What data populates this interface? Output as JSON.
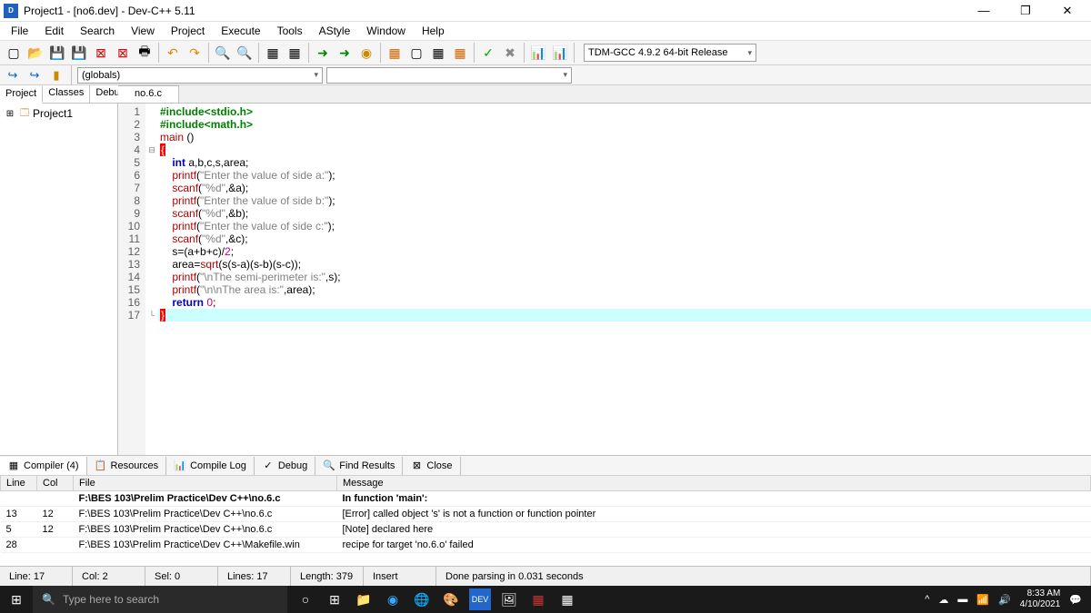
{
  "titlebar": {
    "title": "Project1 - [no6.dev] - Dev-C++ 5.11"
  },
  "menu": [
    "File",
    "Edit",
    "Search",
    "View",
    "Project",
    "Execute",
    "Tools",
    "AStyle",
    "Window",
    "Help"
  ],
  "compiler_select": "TDM-GCC 4.9.2 64-bit Release",
  "scope_select": "(globals)",
  "left_tabs": [
    "Project",
    "Classes",
    "Debug"
  ],
  "left_tab_active": 0,
  "project_name": "Project1",
  "file_tabs": [
    "no.6.c"
  ],
  "code_lines": [
    {
      "n": 1,
      "html": "<span class='kw-green'>#include&lt;stdio.h&gt;</span>"
    },
    {
      "n": 2,
      "html": "<span class='kw-green'>#include&lt;math.h&gt;</span>"
    },
    {
      "n": 3,
      "html": "<span class='kw-red'>main</span> ()\n"
    },
    {
      "n": 4,
      "html": "<span class='brace'>{</span>"
    },
    {
      "n": 5,
      "html": "    <span class='kw-blue'>int</span> a,b,c,s,area;"
    },
    {
      "n": 6,
      "html": "    <span class='kw-red'>printf</span>(<span class='kw-str'>\"Enter the value of side a:\"</span>);"
    },
    {
      "n": 7,
      "html": "    <span class='kw-red'>scanf</span>(<span class='kw-str'>\"%d\"</span>,&amp;a);"
    },
    {
      "n": 8,
      "html": "    <span class='kw-red'>printf</span>(<span class='kw-str'>\"Enter the value of side b:\"</span>);"
    },
    {
      "n": 9,
      "html": "    <span class='kw-red'>scanf</span>(<span class='kw-str'>\"%d\"</span>,&amp;b);"
    },
    {
      "n": 10,
      "html": "    <span class='kw-red'>printf</span>(<span class='kw-str'>\"Enter the value of side c:\"</span>);"
    },
    {
      "n": 11,
      "html": "    <span class='kw-red'>scanf</span>(<span class='kw-str'>\"%d\"</span>,&amp;c);"
    },
    {
      "n": 12,
      "html": "    s=(a+b+c)/<span class='kw-num'>2</span>;"
    },
    {
      "n": 13,
      "html": "    area=<span class='kw-red'>sqrt</span>(s(s-a)(s-b)(s-c));"
    },
    {
      "n": 14,
      "html": "    <span class='kw-red'>printf</span>(<span class='kw-str'>\"\\nThe semi-perimeter is:\"</span>,s);"
    },
    {
      "n": 15,
      "html": "    <span class='kw-red'>printf</span>(<span class='kw-str'>\"\\n\\nThe area is:\"</span>,area);"
    },
    {
      "n": 16,
      "html": "    <span class='kw-blue'>return</span> <span class='kw-num'>0</span>;"
    },
    {
      "n": 17,
      "html": "<span class='brace'>}</span>"
    }
  ],
  "bottom_tabs": [
    {
      "icon": "▦",
      "label": "Compiler (4)"
    },
    {
      "icon": "📋",
      "label": "Resources"
    },
    {
      "icon": "📊",
      "label": "Compile Log"
    },
    {
      "icon": "✓",
      "label": "Debug"
    },
    {
      "icon": "🔍",
      "label": "Find Results"
    },
    {
      "icon": "⊠",
      "label": "Close"
    }
  ],
  "compiler_headers": [
    "Line",
    "Col",
    "File",
    "Message"
  ],
  "compiler_rows": [
    {
      "line": "",
      "col": "",
      "file": "F:\\BES 103\\Prelim Practice\\Dev C++\\no.6.c",
      "msg": "In function 'main':",
      "bold": true
    },
    {
      "line": "13",
      "col": "12",
      "file": "F:\\BES 103\\Prelim Practice\\Dev C++\\no.6.c",
      "msg": "[Error] called object 's' is not a function or function pointer",
      "bold": false
    },
    {
      "line": "5",
      "col": "12",
      "file": "F:\\BES 103\\Prelim Practice\\Dev C++\\no.6.c",
      "msg": "[Note] declared here",
      "bold": false
    },
    {
      "line": "28",
      "col": "",
      "file": "F:\\BES 103\\Prelim Practice\\Dev C++\\Makefile.win",
      "msg": "recipe for target 'no.6.o' failed",
      "bold": false
    }
  ],
  "status": {
    "line": "Line:   17",
    "col": "Col:   2",
    "sel": "Sel:   0",
    "lines": "Lines:   17",
    "length": "Length:   379",
    "mode": "Insert",
    "parse": "Done parsing in 0.031 seconds"
  },
  "taskbar": {
    "search_placeholder": "Type here to search",
    "time": "8:33 AM",
    "date": "4/10/2021"
  }
}
